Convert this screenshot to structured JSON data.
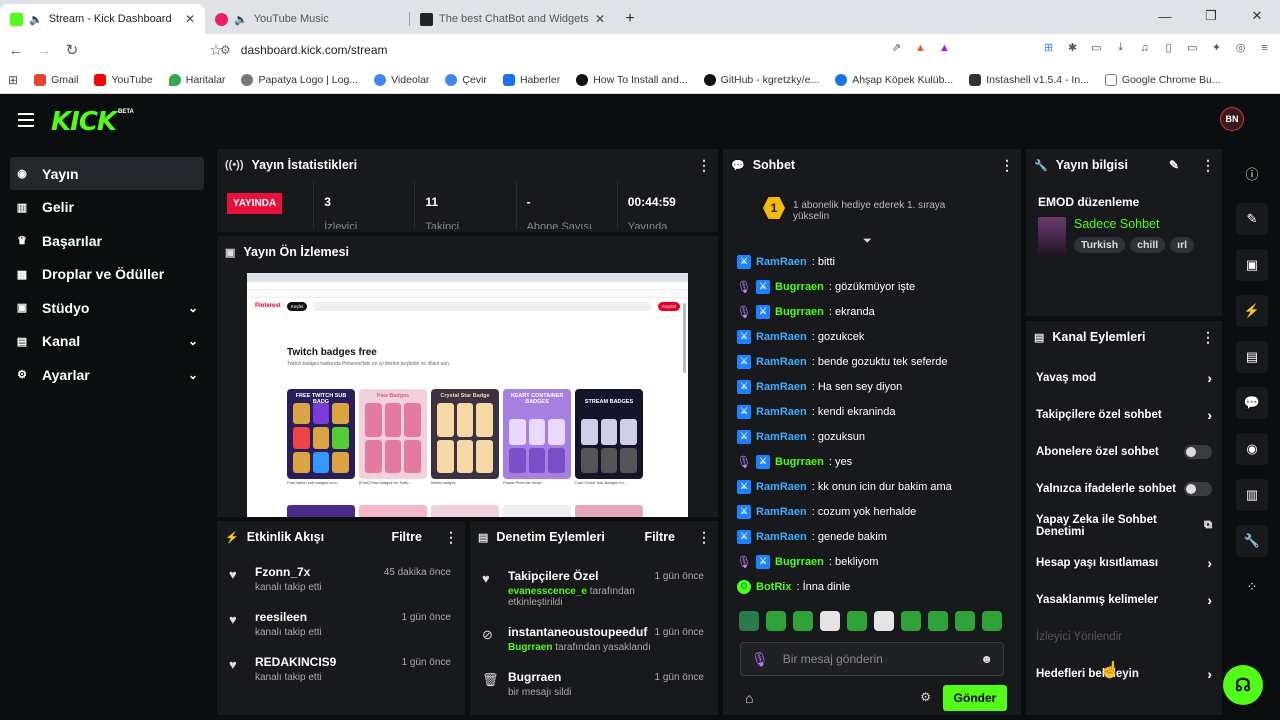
{
  "browser": {
    "tabs": [
      {
        "title": "Stream - Kick Dashboard",
        "color": "#53fc18"
      },
      {
        "title": "YouTube Music",
        "color": "#e91e63"
      },
      {
        "title": "The best ChatBot and Widgets for Kic",
        "color": "#222222"
      }
    ],
    "new_tab": "+",
    "url": "dashboard.kick.com/stream",
    "bookmarks": [
      {
        "label": "Gmail",
        "color": "#ea4335"
      },
      {
        "label": "YouTube",
        "color": "#ff0000"
      },
      {
        "label": "Haritalar",
        "color": "#34a853"
      },
      {
        "label": "Papatya Logo | Log...",
        "color": "#777777"
      },
      {
        "label": "Videolar",
        "color": "#4285f4"
      },
      {
        "label": "Çevir",
        "color": "#4285f4"
      },
      {
        "label": "Haberler",
        "color": "#1a73e8"
      },
      {
        "label": "How To Install and...",
        "color": "#111111"
      },
      {
        "label": "GitHub - kgretzky/e...",
        "color": "#111111"
      },
      {
        "label": "Ahşap Köpek Kulüb...",
        "color": "#1a73e8"
      },
      {
        "label": "Instashell v1.5.4 - In...",
        "color": "#333333"
      },
      {
        "label": "Google Chrome Bu...",
        "color": "#777777"
      }
    ]
  },
  "app": {
    "logo": "KICK",
    "beta": "BETA",
    "avatar": "BN",
    "accent": "#53fc18",
    "nav": [
      {
        "label": "Yayın",
        "icon": "((•))",
        "selected": true,
        "chevron": false
      },
      {
        "label": "Gelir",
        "icon": "▥",
        "selected": false,
        "chevron": false
      },
      {
        "label": "Başarılar",
        "icon": "🏆",
        "selected": false,
        "chevron": false
      },
      {
        "label": "Droplar ve Ödüller",
        "icon": "▦",
        "selected": false,
        "chevron": false
      },
      {
        "label": "Stüdyo",
        "icon": "▣",
        "selected": false,
        "chevron": true
      },
      {
        "label": "Kanal",
        "icon": "▤",
        "selected": false,
        "chevron": true
      },
      {
        "label": "Ayarlar",
        "icon": "⚙",
        "selected": false,
        "chevron": true
      }
    ]
  },
  "stats": {
    "title": "Yayın İstatistikleri",
    "live_badge": "YAYINDA",
    "items": [
      {
        "value": "3",
        "label": "İzleyici"
      },
      {
        "value": "11",
        "label": "Takipçi"
      },
      {
        "value": "-",
        "label": "Abone Sayısı"
      },
      {
        "value": "00:44:59",
        "label": "Yayında"
      }
    ]
  },
  "preview": {
    "title": "Yayın Ön İzlemesi",
    "page_heading": "Twitch badges free",
    "page_desc": "Twitch badges hakkında Pinterest'teki en iyi fikirleri keşfedin ve ilham alın.",
    "brand": "Pinterest",
    "signin": "Kaydol",
    "cards": [
      {
        "caption": "FREE TWITCH SUB BADG",
        "bg": "#2a1d5c",
        "tile": "#d9a441"
      },
      {
        "caption": "Paw Badges",
        "bg": "#f3d1dc",
        "tile": "#e47aa2"
      },
      {
        "caption": "Crystal Star Badge",
        "bg": "#3b3140",
        "tile": "#f4d9a6"
      },
      {
        "caption": "HEART CONTAINER BADGES",
        "bg": "#a67fe0",
        "tile": "#e9d9ff"
      },
      {
        "caption": "STREAM BADGES",
        "bg": "#14142a",
        "tile": "#cfcfe6"
      }
    ],
    "card_captions": [
      "Free twitch sub badges icon...",
      "[Free] Paw badges for Twitc...",
      "twitch badges",
      "Purple Pixel Art Heart...",
      "Cute Ghost Sub Badges for..."
    ]
  },
  "activity": {
    "title": "Etkinlik Akışı",
    "filter": "Filtre",
    "items": [
      {
        "name": "Fzonn_7x",
        "desc": "kanalı takip etti",
        "time": "45 dakika önce"
      },
      {
        "name": "reesileen",
        "desc": "kanalı takip etti",
        "time": "1 gün önce"
      },
      {
        "name": "REDAKINCIS9",
        "desc": "kanalı takip etti",
        "time": "1 gün önce"
      }
    ]
  },
  "moderation": {
    "title": "Denetim Eylemleri",
    "filter": "Filtre",
    "items": [
      {
        "name": "Takipçilere Özel",
        "actor": "evanesscence_e",
        "desc": "tarafından",
        "desc2": "etkinleştirildi",
        "time": "1 gün önce",
        "icon": "♥"
      },
      {
        "name": "instantaneoustoupeeduf",
        "actor": "Bugrraen",
        "desc": "tarafından yasaklandı",
        "desc2": "",
        "time": "1 gün önce",
        "icon": "⊘"
      },
      {
        "name": "Bugrraen",
        "actor": "",
        "desc": "bir mesajı sildi",
        "desc2": "",
        "time": "1 gün önce",
        "icon": "🗑"
      }
    ]
  },
  "chat": {
    "title": "Sohbet",
    "gift_badge": "1",
    "gift_text": "1 abonelik hediye ederek 1. sıraya yükselin",
    "messages": [
      {
        "user": "RamRaen",
        "text": ": bitti",
        "mic": false,
        "bot": false
      },
      {
        "user": "Bugrraen",
        "text": ": gözükmüyor işte",
        "mic": true,
        "bot": false
      },
      {
        "user": "Bugrraen",
        "text": ": ekranda",
        "mic": true,
        "bot": false
      },
      {
        "user": "RamRaen",
        "text": ": gozukcek",
        "mic": false,
        "bot": false
      },
      {
        "user": "RamRaen",
        "text": ": bende gozuktu tek seferde",
        "mic": false,
        "bot": false
      },
      {
        "user": "RamRaen",
        "text": ": Ha sen sey diyon",
        "mic": false,
        "bot": false
      },
      {
        "user": "RamRaen",
        "text": ": kendi ekraninda",
        "mic": false,
        "bot": false
      },
      {
        "user": "RamRaen",
        "text": ": gozuksun",
        "mic": false,
        "bot": false
      },
      {
        "user": "Bugrraen",
        "text": ": yes",
        "mic": true,
        "bot": false
      },
      {
        "user": "RamRaen",
        "text": ": kk onun icin dur bakim ama",
        "mic": false,
        "bot": false
      },
      {
        "user": "RamRaen",
        "text": ": cozum yok herhalde",
        "mic": false,
        "bot": false
      },
      {
        "user": "RamRaen",
        "text": ": genede bakim",
        "mic": false,
        "bot": false
      },
      {
        "user": "Bugrraen",
        "text": ": bekliyom",
        "mic": true,
        "bot": false
      },
      {
        "user": "BotRix",
        "text": ": İnna dinle",
        "mic": false,
        "bot": true
      }
    ],
    "input_placeholder": "Bir mesaj gönderin",
    "send": "Gönder"
  },
  "stream_info": {
    "title": "Yayın bilgisi",
    "stream_title": "EMOD düzenleme",
    "category": "Sadece Sohbet",
    "tags": [
      "Turkish",
      "chill",
      "ırl"
    ]
  },
  "channel_actions": {
    "title": "Kanal Eylemleri",
    "items": [
      {
        "label": "Yavaş mod",
        "control": "chevron"
      },
      {
        "label": "Takipçilere özel sohbet",
        "control": "chevron"
      },
      {
        "label": "Abonelere özel sohbet",
        "control": "toggle",
        "on": false
      },
      {
        "label": "Yalnızca ifadelerle sohbet",
        "control": "toggle",
        "on": false
      },
      {
        "label": "Yapay Zeka ile Sohbet Denetimi",
        "control": "external"
      },
      {
        "label": "Hesap yaşı kısıtlaması",
        "control": "chevron"
      },
      {
        "label": "Yasaklanmış kelimeler",
        "control": "chevron"
      },
      {
        "label": "İzleyici Yönlendir",
        "control": "none",
        "dim": true
      },
      {
        "label": "Hedefleri belirleyin",
        "control": "chevron"
      }
    ]
  }
}
